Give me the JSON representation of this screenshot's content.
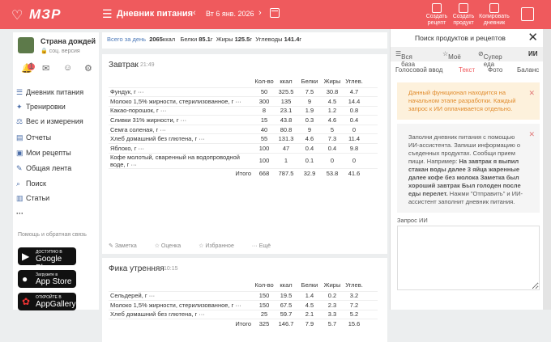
{
  "app": {
    "logo": "МЗР",
    "title": "Дневник питания",
    "date": "Вт 6 янв. 2026"
  },
  "toolbar": {
    "create_recipe": "Создать рецепт",
    "create_product": "Создать продукт",
    "copy_diary": "Копировать дневник"
  },
  "user": {
    "name": "Страна дождей",
    "sub": "соц. версия",
    "notifications": "1"
  },
  "sidebar": {
    "items": [
      "Дневник питания",
      "Тренировки",
      "Вес и измерения",
      "Отчеты",
      "Мои рецепты",
      "Общая лента",
      "Поиск",
      "Статьи",
      "···"
    ],
    "help": "Помощь и обратная связь",
    "stores": [
      {
        "line1": "ДОСТУПНО В",
        "line2": "Google Play"
      },
      {
        "line1": "Загрузите в",
        "line2": "App Store"
      },
      {
        "line1": "ОТКРОЙТЕ В",
        "line2": "AppGallery"
      }
    ]
  },
  "summary": {
    "label": "Всего за день",
    "kcal": "2065",
    "kcal_unit": "ккал",
    "belki_label": "Белки",
    "belki": "85.1",
    "zhiry_label": "Жиры",
    "zhiry": "125.5",
    "ugl_label": "Углеводы",
    "ugl": "141.4",
    "unit": "г"
  },
  "meals": [
    {
      "title": "Завтрак",
      "time": "21:49",
      "columns": [
        "",
        "Кол-во",
        "ккал",
        "Белки",
        "Жиры",
        "Углев.",
        ""
      ],
      "rows": [
        [
          "Фундук, г ···",
          "50",
          "325.5",
          "7.5",
          "30.8",
          "4.7"
        ],
        [
          "Молоко 1,5% жирности, стерилизованное, г ···",
          "300",
          "135",
          "9",
          "4.5",
          "14.4"
        ],
        [
          "Какао-порошок, г ···",
          "8",
          "23.1",
          "1.9",
          "1.2",
          "0.8"
        ],
        [
          "Сливки 31% жирности, г ···",
          "15",
          "43.8",
          "0.3",
          "4.6",
          "0.4"
        ],
        [
          "Семга соленая, г ···",
          "40",
          "80.8",
          "9",
          "5",
          "0"
        ],
        [
          "Хлеб домашний без глютена, г ···",
          "55",
          "131.3",
          "4.6",
          "7.3",
          "11.4"
        ],
        [
          "Яблоко, г ···",
          "100",
          "47",
          "0.4",
          "0.4",
          "9.8"
        ],
        [
          "Кофе молотый, сваренный на водопроводной воде, г ···",
          "100",
          "1",
          "0.1",
          "0",
          "0"
        ]
      ],
      "total": [
        "Итого",
        "668",
        "787.5",
        "32.9",
        "53.8",
        "41.6"
      ],
      "foot": [
        "Заметка",
        "Оценка",
        "Избранное",
        "Ещё"
      ]
    },
    {
      "title": "Фика утренняя",
      "time": "10:15",
      "columns": [
        "",
        "Кол-во",
        "ккал",
        "Белки",
        "Жиры",
        "Углев.",
        ""
      ],
      "rows": [
        [
          "Сельдерей, г ···",
          "150",
          "19.5",
          "1.4",
          "0.2",
          "3.2"
        ],
        [
          "Молоко 1,5% жирности, стерилизованное, г ···",
          "150",
          "67.5",
          "4.5",
          "2.3",
          "7.2"
        ],
        [
          "Хлеб домашний без глютена, г ···",
          "25",
          "59.7",
          "2.1",
          "3.3",
          "5.2"
        ]
      ],
      "total": [
        "Итого",
        "325",
        "146.7",
        "7.9",
        "5.7",
        "15.6"
      ]
    }
  ],
  "panel": {
    "title": "Поиск продуктов и рецептов",
    "tabs1": [
      "Вся база",
      "Моё",
      "Супер еда",
      "ИИ"
    ],
    "tabs2": [
      "Голосовой ввод",
      "Текст",
      "Фото",
      "Баланс"
    ],
    "note1": "Данный функционал находится на начальном этапе разработки. Каждый запрос к ИИ оплачивается отдельно.",
    "note2_a": "Заполни дневник питания с помощью ИИ-ассистента. Запиши информацию о съеденных продуктах. Сообщи прием пищи. Например: ",
    "note2_b": "На завтрак я выпил стакан воды далее 3 яйца жаренные далее кофе без молока Заметка был хороший завтрак Был голоден после еды перелет.",
    "note2_c": " Нажми \"Отправить\" и ИИ-ассистент заполнит дневник питания.",
    "label": "Запрос ИИ",
    "placeholder": ""
  },
  "colors": {
    "brand": "#ef5a5d",
    "link": "#4a78b8",
    "warn_bg": "#fdf1dc"
  }
}
